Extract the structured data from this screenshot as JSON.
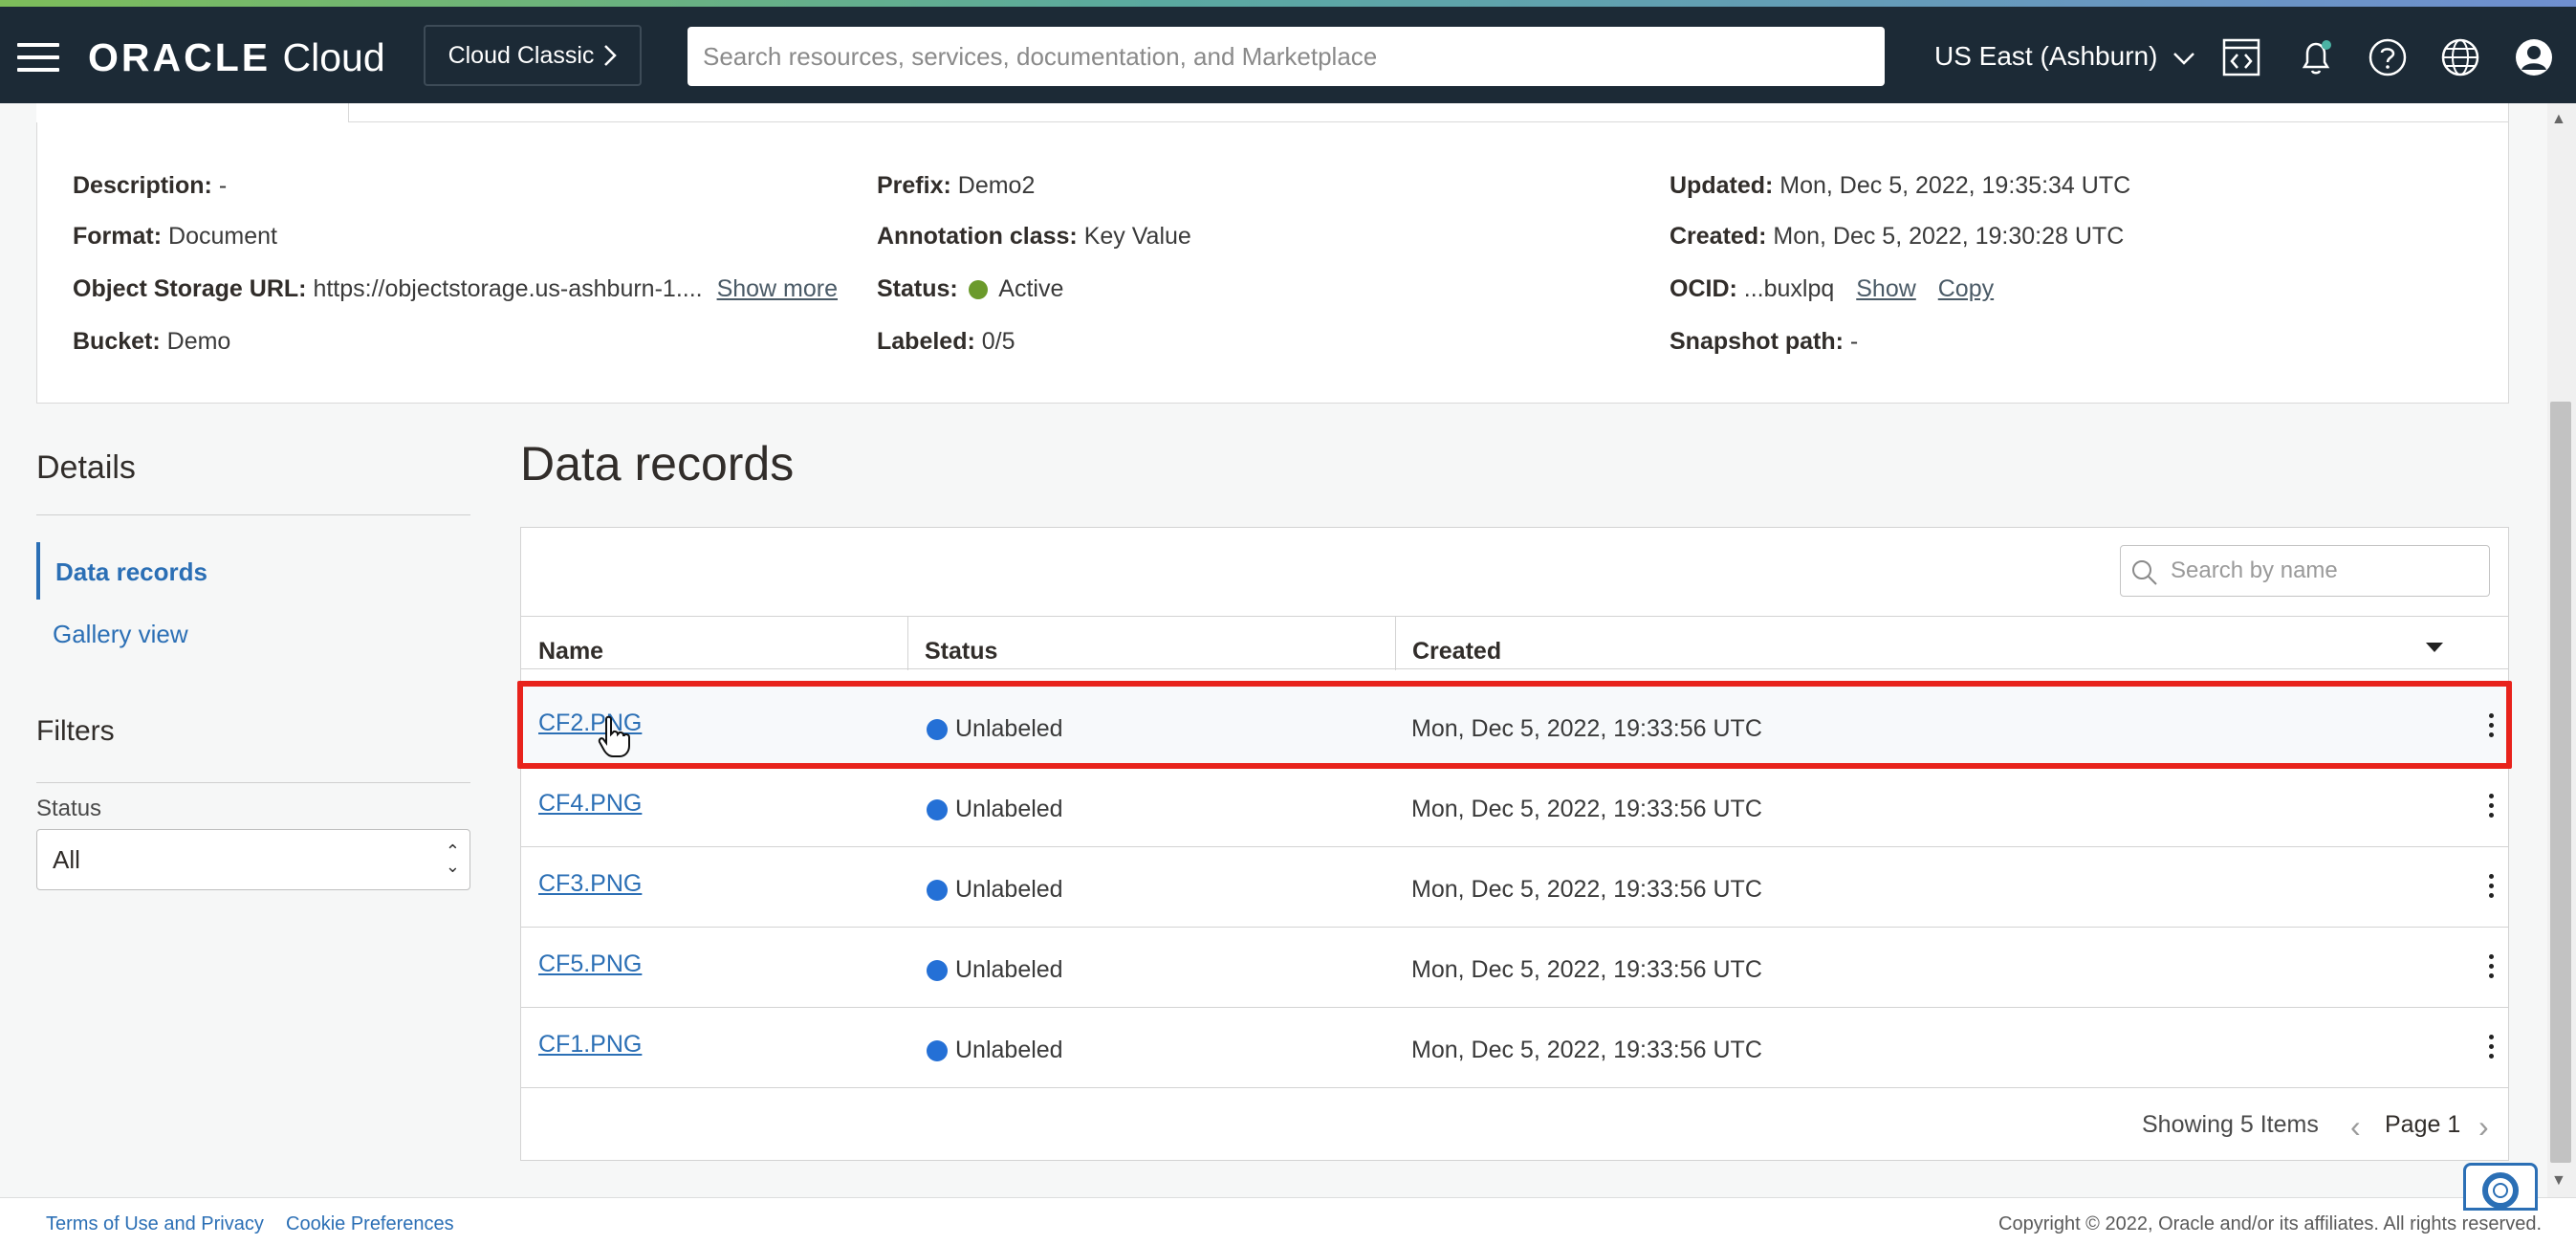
{
  "topbar": {
    "brand_main": "ORACLE",
    "brand_sub": "Cloud",
    "classic_label": "Cloud Classic",
    "search_placeholder": "Search resources, services, documentation, and Marketplace",
    "region": "US East (Ashburn)"
  },
  "details": {
    "description_k": "Description:",
    "description_v": "-",
    "format_k": "Format:",
    "format_v": "Document",
    "url_k": "Object Storage URL:",
    "url_v": "https://objectstorage.us-ashburn-1....",
    "show_more": "Show more",
    "bucket_k": "Bucket:",
    "bucket_v": "Demo",
    "prefix_k": "Prefix:",
    "prefix_v": "Demo2",
    "annotation_k": "Annotation class:",
    "annotation_v": "Key Value",
    "status_k": "Status:",
    "status_v": "Active",
    "labeled_k": "Labeled:",
    "labeled_v": "0/5",
    "updated_k": "Updated:",
    "updated_v": "Mon, Dec 5, 2022, 19:35:34 UTC",
    "created_k": "Created:",
    "created_v": "Mon, Dec 5, 2022, 19:30:28 UTC",
    "ocid_k": "OCID:",
    "ocid_v": "...buxlpq",
    "ocid_show": "Show",
    "ocid_copy": "Copy",
    "snapshot_k": "Snapshot path:",
    "snapshot_v": "-"
  },
  "sidebar": {
    "details_heading": "Details",
    "nav_active": "Data records",
    "nav_gallery": "Gallery view",
    "filters_heading": "Filters",
    "status_label": "Status",
    "status_value": "All"
  },
  "main": {
    "title": "Data records",
    "search_placeholder": "Search by name",
    "columns": {
      "name": "Name",
      "status": "Status",
      "created": "Created"
    },
    "rows": [
      {
        "name": "CF2.PNG",
        "status": "Unlabeled",
        "created": "Mon, Dec 5, 2022, 19:33:56 UTC"
      },
      {
        "name": "CF4.PNG",
        "status": "Unlabeled",
        "created": "Mon, Dec 5, 2022, 19:33:56 UTC"
      },
      {
        "name": "CF3.PNG",
        "status": "Unlabeled",
        "created": "Mon, Dec 5, 2022, 19:33:56 UTC"
      },
      {
        "name": "CF5.PNG",
        "status": "Unlabeled",
        "created": "Mon, Dec 5, 2022, 19:33:56 UTC"
      },
      {
        "name": "CF1.PNG",
        "status": "Unlabeled",
        "created": "Mon, Dec 5, 2022, 19:33:56 UTC"
      }
    ],
    "showing": "Showing 5 Items",
    "page": "Page 1"
  },
  "footer": {
    "terms": "Terms of Use and Privacy",
    "cookies": "Cookie Preferences",
    "copyright": "Copyright © 2022, Oracle and/or its affiliates. All rights reserved."
  },
  "colors": {
    "topbar_bg": "#1c2a36",
    "link": "#2b6fb5",
    "status_active": "#6b9a2b",
    "status_unlabeled": "#2470d6",
    "highlight_outline": "#e8231c"
  },
  "icons": [
    "hamburger-icon",
    "chevron-right-icon",
    "chevron-down-icon",
    "code-editor-icon",
    "bell-icon",
    "help-icon",
    "globe-icon",
    "user-icon",
    "search-icon",
    "sort-down-icon",
    "kebab-icon",
    "pointer-cursor-icon",
    "lifebuoy-icon"
  ]
}
